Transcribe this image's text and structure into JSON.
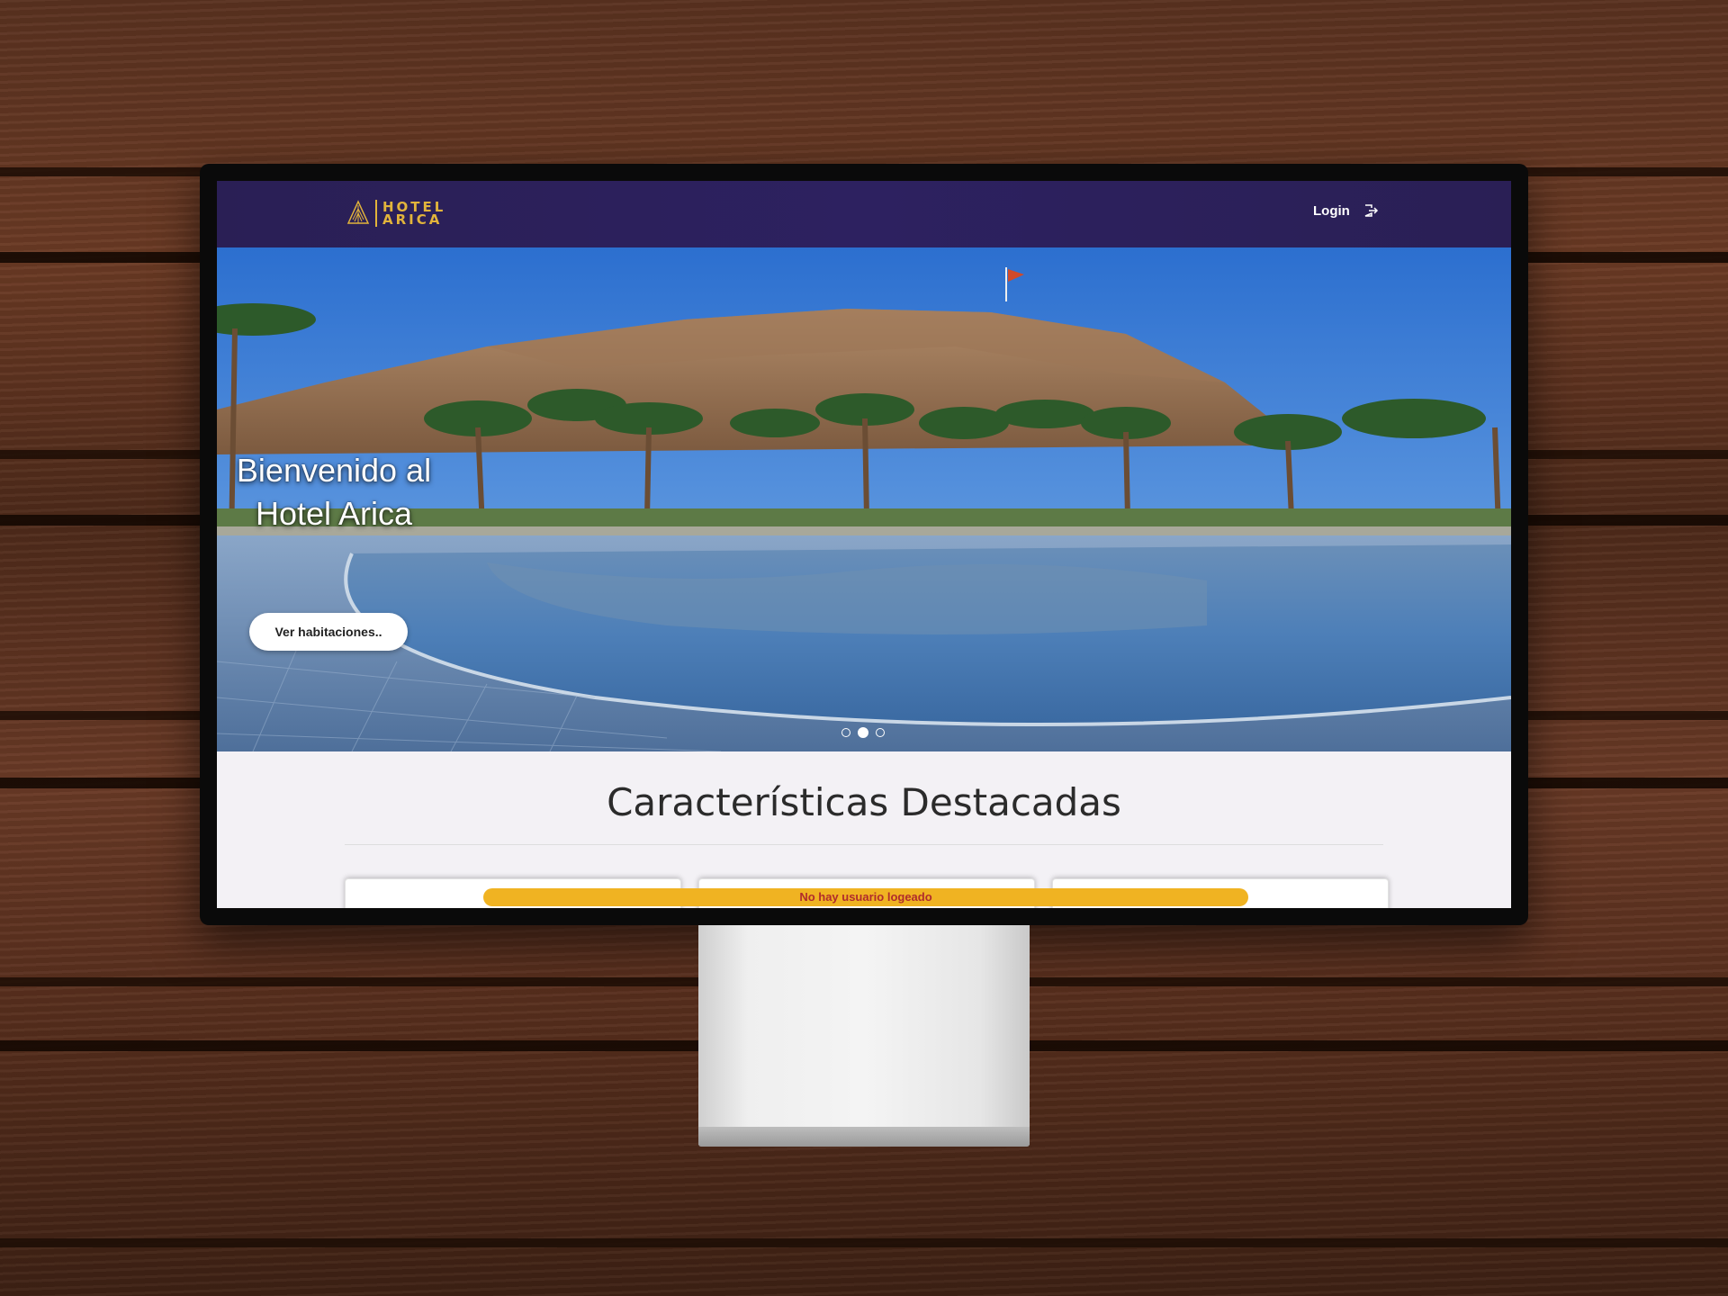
{
  "brand": {
    "line1": "HOTEL",
    "line2": "ARICA"
  },
  "nav": {
    "login_label": "Login"
  },
  "hero": {
    "title_line1": "Bienvenido al",
    "title_line2": "Hotel Arica",
    "button_label": "Ver habitaciones..",
    "carousel_count": 3,
    "carousel_active": 1
  },
  "features": {
    "title": "Características Destacadas"
  },
  "toast": {
    "message": "No hay usuario logeado"
  },
  "colors": {
    "navbar": "#2a1f55",
    "gold": "#e2b43b",
    "toast": "#f0b322",
    "toast_text": "#b02c2c"
  }
}
